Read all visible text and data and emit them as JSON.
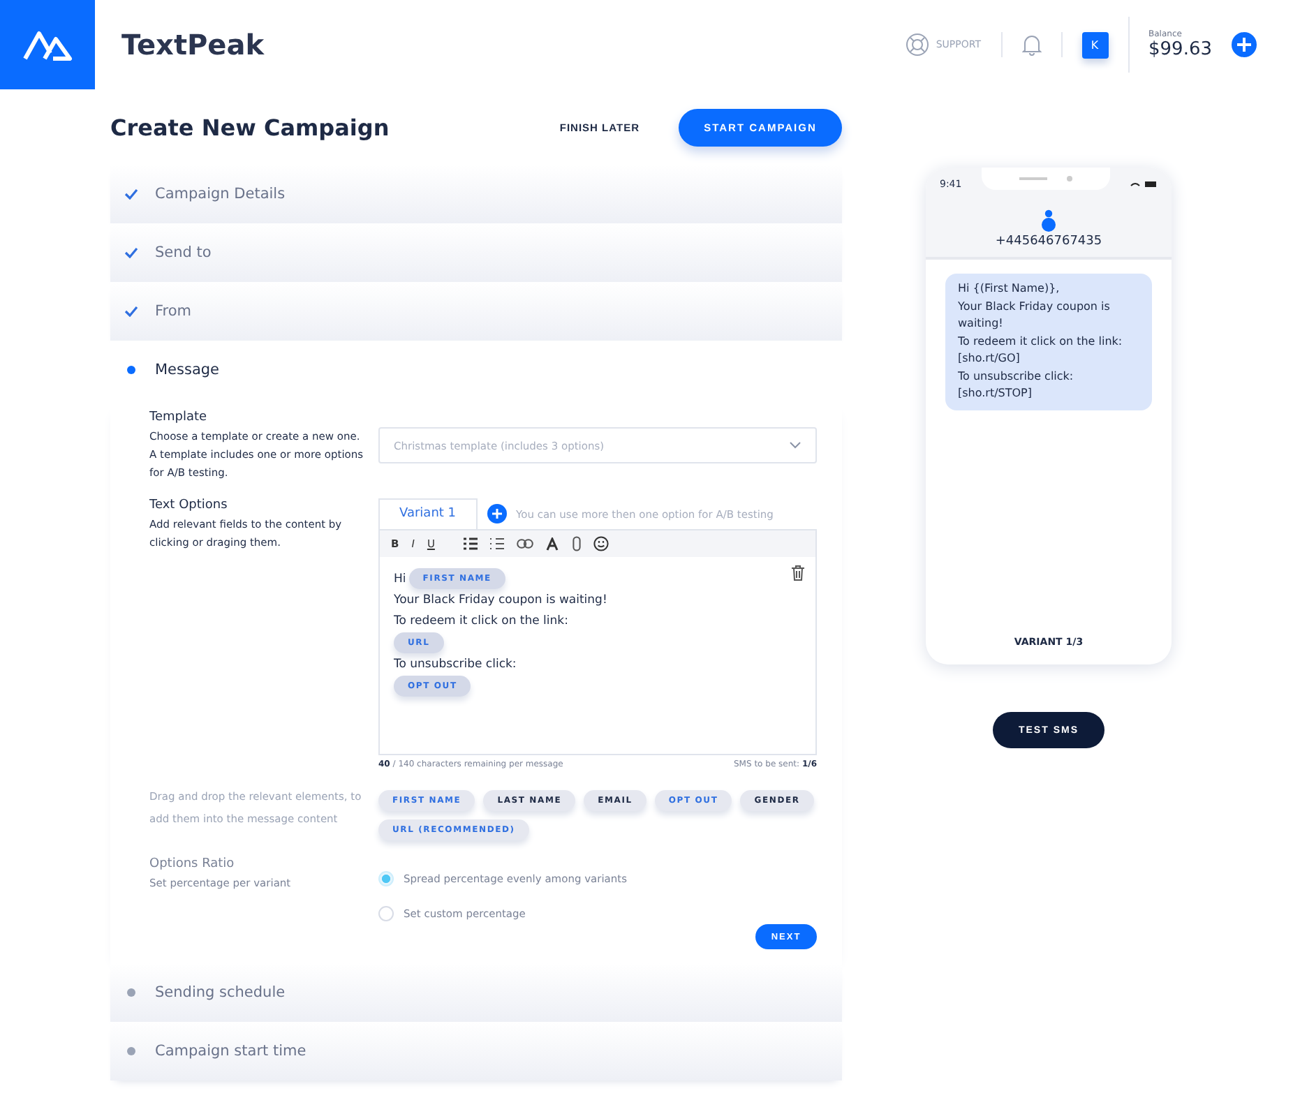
{
  "header": {
    "brand": "TextPeak",
    "support": "SUPPORT",
    "avatar": "K",
    "balance_label": "Balance",
    "balance": "$99.63"
  },
  "page": {
    "title": "Create New Campaign",
    "secondary_action": "FINISH LATER",
    "primary_action": "START CAMPAIGN"
  },
  "steps_before": [
    {
      "label": "Campaign Details",
      "kind": "done"
    },
    {
      "label": "Send to",
      "kind": "done"
    },
    {
      "label": "From",
      "kind": "done"
    },
    {
      "label": "Message",
      "kind": "active"
    }
  ],
  "template": {
    "title": "Template",
    "description": "Choose a template or create a new one. A template includes one or more options for A/B testing.",
    "placeholder": "Christmas template (includes 3 options)"
  },
  "text_options": {
    "title": "Text Options",
    "description": "Add relevant fields to the content by clicking or draging them.",
    "tabs": [
      {
        "label": "Variant 1",
        "selected": true
      }
    ],
    "hint": "You can use more then one option for A/B testing",
    "toolbar": [
      {
        "label": "B",
        "kind": "bold"
      },
      {
        "label": "I",
        "kind": "italic"
      },
      {
        "label": "U",
        "kind": "underline"
      }
    ],
    "lines": [
      [
        {
          "kind": "text",
          "text": "Hi"
        },
        {
          "kind": "chip",
          "text": "FIRST NAME"
        }
      ],
      [
        {
          "kind": "text",
          "text": "Your Black Friday coupon is waiting!"
        }
      ],
      [
        {
          "kind": "text",
          "text": "To redeem it click on the link:"
        }
      ],
      [
        {
          "kind": "chip",
          "text": "URL"
        }
      ],
      [
        {
          "kind": "text",
          "text": "To unsubscribe click:"
        }
      ],
      [
        {
          "kind": "chip",
          "text": "OPT OUT"
        }
      ]
    ],
    "count": "40",
    "count_rest": "/ 140 characters remaining per message",
    "sms_label": "SMS to be sent:",
    "sms_count": "1/6"
  },
  "fields": {
    "description": "Drag and drop the relevant elements, to add them into the message content",
    "chips": [
      {
        "label": "FIRST NAME",
        "used": true
      },
      {
        "label": "LAST NAME",
        "used": false
      },
      {
        "label": "EMAIL",
        "used": false
      },
      {
        "label": "OPT OUT",
        "used": true
      },
      {
        "label": "GENDER",
        "used": false
      },
      {
        "label": "URL (RECOMMENDED)",
        "used": true
      }
    ]
  },
  "ratio": {
    "title": "Options Ratio",
    "description": "Set percentage per variant",
    "options": [
      {
        "label": "Spread percentage evenly among variants",
        "selected": true
      },
      {
        "label": "Set custom percentage",
        "selected": false
      }
    ],
    "next": "NEXT"
  },
  "steps_after": [
    {
      "label": "Sending schedule",
      "kind": "pending"
    },
    {
      "label": "Campaign start time",
      "kind": "pending"
    }
  ],
  "preview": {
    "time": "9:41",
    "number": "+445646767435",
    "message": [
      "Hi {(First Name)},",
      "Your Black Friday coupon is waiting!",
      "To redeem it click on the link:",
      "[sho.rt/GO]",
      "To unsubscribe click:",
      "[sho.rt/STOP]"
    ],
    "variant": "VARIANT 1/3",
    "test_button": "TEST SMS"
  }
}
